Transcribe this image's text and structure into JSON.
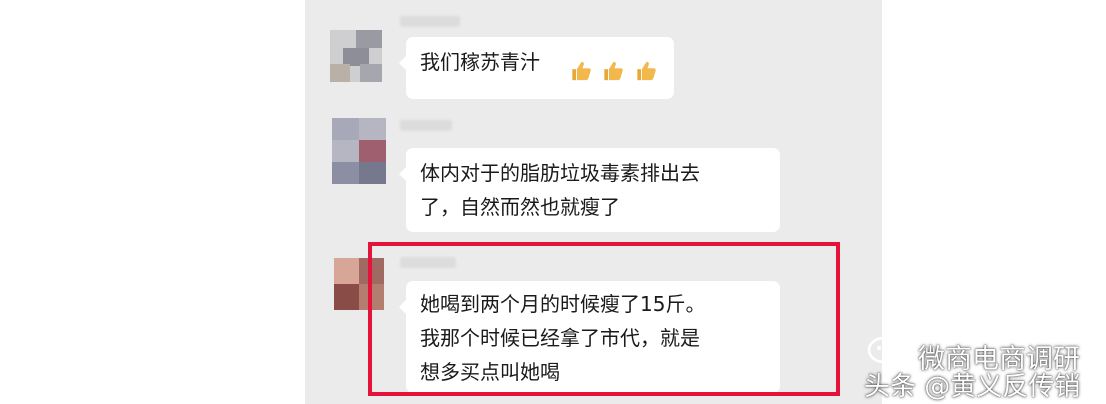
{
  "colors": {
    "chat_background": "#ebebeb",
    "bubble_background": "#ffffff",
    "highlight_border": "#e5123a",
    "thumb_emoji": "#f2b84b"
  },
  "messages": [
    {
      "lines": [
        "我们稼苏青汁"
      ],
      "emoji": [
        "thumbs-up",
        "thumbs-up",
        "thumbs-up"
      ]
    },
    {
      "lines": [
        "体内对于的脂肪垃圾毒素排出去",
        "了，自然而然也就瘦了"
      ]
    },
    {
      "lines": [
        "她喝到两个月的时候瘦了15斤。",
        "我那个时候已经拿了市代，就是",
        "想多买点叫她喝"
      ],
      "highlighted": true
    }
  ],
  "watermark": {
    "channel": "微商电商调研",
    "source": "头条 @黄义反传销"
  }
}
